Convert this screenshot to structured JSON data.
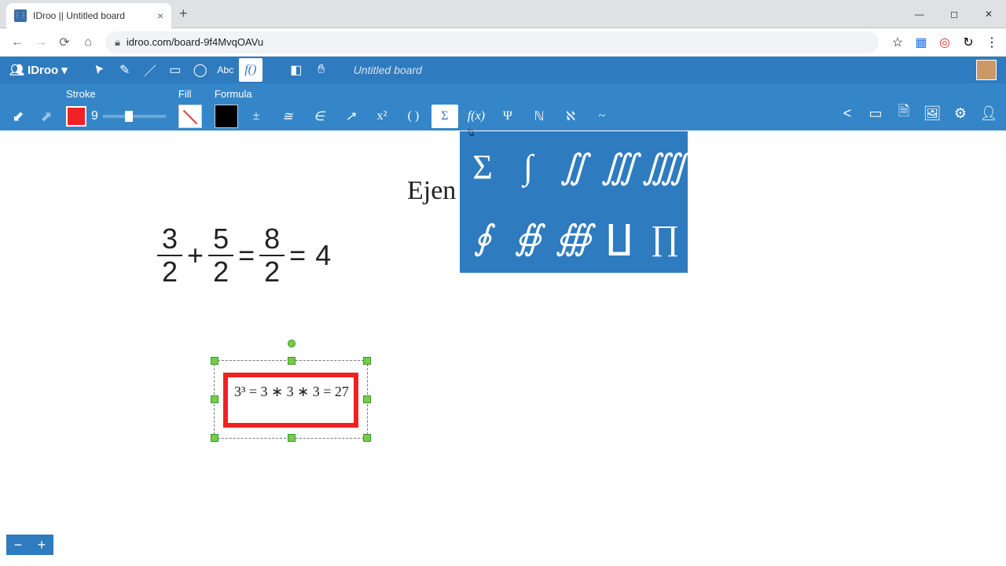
{
  "tab": {
    "title": "IDroo || Untitled board"
  },
  "url": "idroo.com/board-9f4MvqOAVu",
  "brand": "IDroo",
  "board_title": "Untitled board",
  "sub": {
    "stroke_label": "Stroke",
    "stroke_value": "9",
    "fill_label": "Fill",
    "formula_label": "Formula"
  },
  "formula_buttons": {
    "pm": "±",
    "approx": "≅",
    "in": "∈",
    "arrow": "↗",
    "sup": "x²",
    "paren": "( )",
    "sigma": "Σ",
    "fx": "f(x)",
    "psi": "Ψ",
    "N": "ℕ",
    "aleph": "ℵ",
    "tilde": "~"
  },
  "panel": {
    "r1": [
      "Σ",
      "∫",
      "∬",
      "∭",
      "⨌"
    ],
    "r2": [
      "∮",
      "∯",
      "∰",
      "∐",
      "∏"
    ]
  },
  "canvas": {
    "ejen_text": "Ejen",
    "fraction": {
      "a_num": "3",
      "a_den": "2",
      "b_num": "5",
      "b_den": "2",
      "c_num": "8",
      "c_den": "2",
      "result": "4"
    },
    "selected_math": "3³ = 3 ∗ 3 ∗ 3 = 27"
  },
  "zoom": {
    "minus": "−",
    "plus": "+"
  }
}
